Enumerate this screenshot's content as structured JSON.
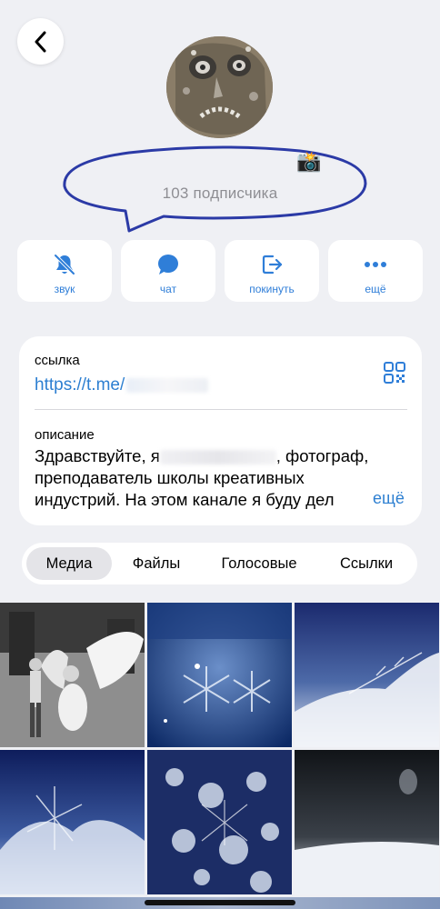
{
  "profile": {
    "subscribers": "103 подписчика",
    "status_emoji": "📸"
  },
  "actions": [
    {
      "label": "звук",
      "icon": "bell-slash-icon"
    },
    {
      "label": "чат",
      "icon": "chat-bubble-icon"
    },
    {
      "label": "покинуть",
      "icon": "leave-icon"
    },
    {
      "label": "ещё",
      "icon": "ellipsis-icon"
    }
  ],
  "info": {
    "link_label": "ссылка",
    "link_value": "https://t.me/",
    "description_label": "описание",
    "description_line1_a": "Здравствуйте, я",
    "description_line1_b": ", фотограф,",
    "description_line2": "преподаватель школы креативных",
    "description_line3": "индустрий. На этом канале я буду дел",
    "more": "ещё"
  },
  "tabs": [
    "Медиа",
    "Файлы",
    "Голосовые",
    "Ссылки"
  ],
  "colors": {
    "accent": "#2f7ed8",
    "background": "#eff0f4",
    "annotation": "#2b3aa6"
  }
}
